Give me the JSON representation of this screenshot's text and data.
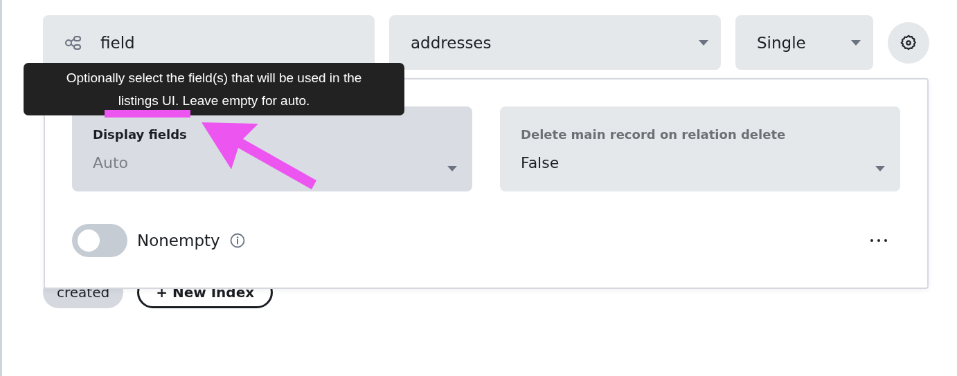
{
  "field_name": {
    "value": "field"
  },
  "collection_select": {
    "value": "addresses"
  },
  "type_select": {
    "value": "Single"
  },
  "chips": [
    {
      "kind": "chip",
      "label": "created"
    },
    {
      "kind": "button",
      "label": "+ New Index"
    }
  ],
  "options_panel": {
    "selects": [
      {
        "label": "Display fields",
        "placeholder": "Auto",
        "hovered": true
      },
      {
        "label": "Delete main record on relation delete",
        "value": "False",
        "hovered": false
      }
    ],
    "toggle": {
      "label": "Nonempty",
      "on": false
    }
  },
  "tooltip": {
    "text": "Optionally select the field(s) that will be used in the listings UI. Leave empty for auto."
  }
}
